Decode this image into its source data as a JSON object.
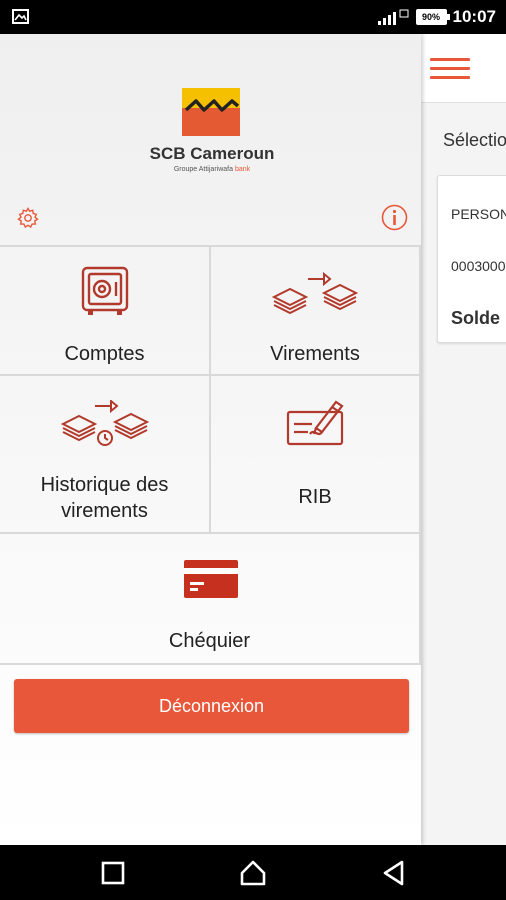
{
  "statusbar": {
    "time": "10:07",
    "battery": "90%",
    "icons": [
      "image-icon",
      "signal-icon",
      "battery-icon"
    ]
  },
  "drawer": {
    "brand": {
      "name": "SCB Cameroun",
      "subtitle": "Groupe Attijariwafa",
      "subtitle_accent": "bank"
    },
    "tiles": [
      {
        "label": "Comptes",
        "icon": "safe-icon"
      },
      {
        "label": "Virements",
        "icon": "money-transfer-icon"
      },
      {
        "label": "Historique des virements",
        "icon": "transfer-history-icon"
      },
      {
        "label": "RIB",
        "icon": "cheque-sign-icon"
      },
      {
        "label": "Chéquier",
        "icon": "chequebook-icon"
      }
    ],
    "logout_label": "Déconnexion",
    "accent_color": "#e8573a"
  },
  "background": {
    "select_text": "Sélectio",
    "card": {
      "line1": "PERSON",
      "line2": "0003000",
      "line3": "Solde"
    }
  },
  "navbar": {
    "buttons": [
      "back-icon",
      "home-icon",
      "recents-icon"
    ]
  }
}
